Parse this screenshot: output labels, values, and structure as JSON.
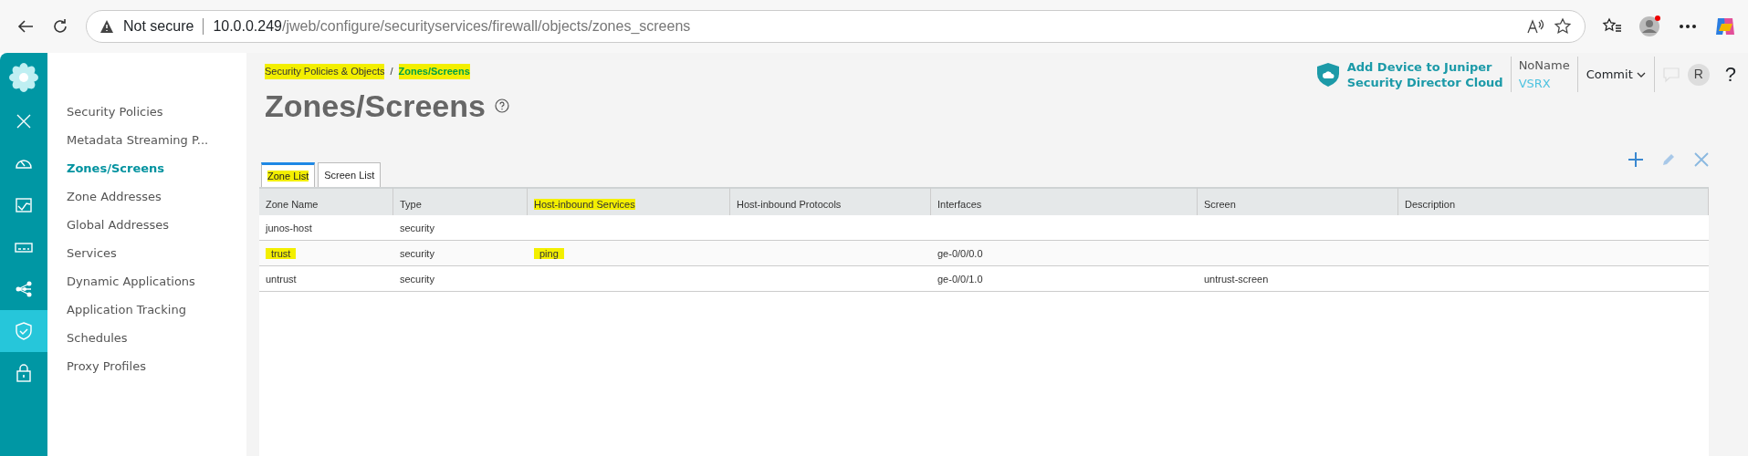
{
  "browser": {
    "security": "Not secure",
    "url_host": "10.0.0.249",
    "url_path": "/jweb/configure/securityservices/firewall/objects/zones_screens"
  },
  "rail": {
    "items": [
      {
        "kind": "close",
        "selected": false
      },
      {
        "kind": "gauge",
        "selected": false
      },
      {
        "kind": "chart",
        "selected": false
      },
      {
        "kind": "device",
        "selected": false
      },
      {
        "kind": "share",
        "selected": false
      },
      {
        "kind": "shield",
        "selected": true
      },
      {
        "kind": "lock",
        "selected": false
      }
    ]
  },
  "nav": {
    "items": [
      {
        "label": "Security Policies",
        "selected": false
      },
      {
        "label": "Metadata Streaming P...",
        "selected": false
      },
      {
        "label": "Zones/Screens",
        "selected": true
      },
      {
        "label": "Zone Addresses",
        "selected": false
      },
      {
        "label": "Global Addresses",
        "selected": false
      },
      {
        "label": "Services",
        "selected": false
      },
      {
        "label": "Dynamic Applications",
        "selected": false
      },
      {
        "label": "Application Tracking",
        "selected": false
      },
      {
        "label": "Schedules",
        "selected": false
      },
      {
        "label": "Proxy Profiles",
        "selected": false
      }
    ]
  },
  "breadcrumb": [
    {
      "label": "Security Policies & Objects",
      "current": false,
      "highlighted": true
    },
    {
      "label": "/",
      "current": false,
      "highlighted": false
    },
    {
      "label": "Zones/Screens",
      "current": true,
      "highlighted": true
    }
  ],
  "title": "Zones/Screens",
  "header": {
    "cloud_link": [
      "Add Device to Juniper",
      "Security Director Cloud"
    ],
    "device_name": "NoName",
    "device_model": "VSRX",
    "commit": "Commit",
    "avatar": "R",
    "help": "?"
  },
  "tabs": [
    {
      "label": "Zone List",
      "selected": true,
      "highlighted": true
    },
    {
      "label": "Screen List",
      "selected": false,
      "highlighted": false
    }
  ],
  "table": {
    "columns": [
      {
        "label": "Zone Name",
        "highlighted": false
      },
      {
        "label": "Type",
        "highlighted": false
      },
      {
        "label": "Host-inbound Services",
        "highlighted": true
      },
      {
        "label": "Host-inbound Protocols",
        "highlighted": false
      },
      {
        "label": "Interfaces",
        "highlighted": false
      },
      {
        "label": "Screen",
        "highlighted": false
      },
      {
        "label": "Description",
        "highlighted": false
      }
    ],
    "rows": [
      {
        "cells": [
          {
            "text": "junos-host",
            "highlighted": false
          },
          {
            "text": "security",
            "highlighted": false
          },
          null,
          null,
          null,
          null,
          null
        ]
      },
      {
        "cells": [
          {
            "text": "trust",
            "highlighted": true
          },
          {
            "text": "security",
            "highlighted": false
          },
          {
            "text": "ping",
            "highlighted": true
          },
          null,
          {
            "text": "ge-0/0/0.0",
            "highlighted": false
          },
          null,
          null
        ]
      },
      {
        "cells": [
          {
            "text": "untrust",
            "highlighted": false
          },
          {
            "text": "security",
            "highlighted": false
          },
          null,
          null,
          {
            "text": "ge-0/0/1.0",
            "highlighted": false
          },
          {
            "text": "untrust-screen",
            "highlighted": false
          },
          null
        ]
      }
    ]
  }
}
